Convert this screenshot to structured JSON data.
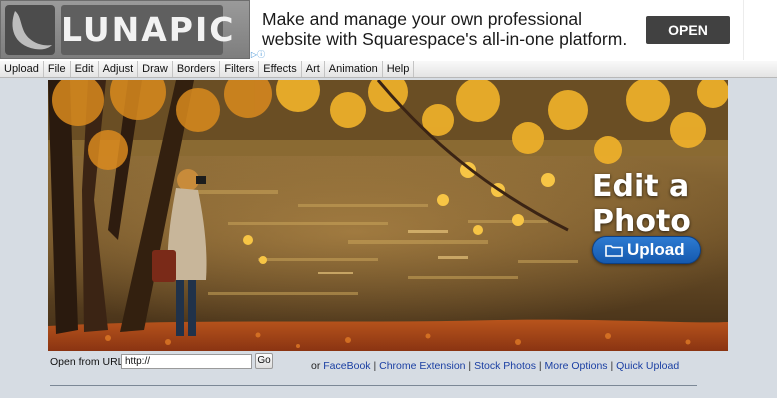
{
  "header": {
    "logo_text": "LUNAPIC",
    "ad_text": "Make and manage your own professional website with Squarespace's all-in-one platform.",
    "ad_button": "OPEN",
    "ad_choices": "▷ⓘ"
  },
  "menu": [
    "Upload",
    "File",
    "Edit",
    "Adjust",
    "Draw",
    "Borders",
    "Filters",
    "Effects",
    "Art",
    "Animation",
    "Help"
  ],
  "hero": {
    "title": "Edit a Photo",
    "upload_button": "Upload"
  },
  "url_bar": {
    "label": "Open from URL:",
    "value": "http://",
    "go_label": "Go"
  },
  "links": {
    "prefix": "or",
    "items": [
      "FaceBook",
      "Chrome Extension",
      "Stock Photos",
      "More Options",
      "Quick Upload"
    ],
    "separator": "|"
  },
  "colors": {
    "link": "#1a3fa3",
    "upload_button": "#1f69c0",
    "page_background": "#d6dce3"
  }
}
